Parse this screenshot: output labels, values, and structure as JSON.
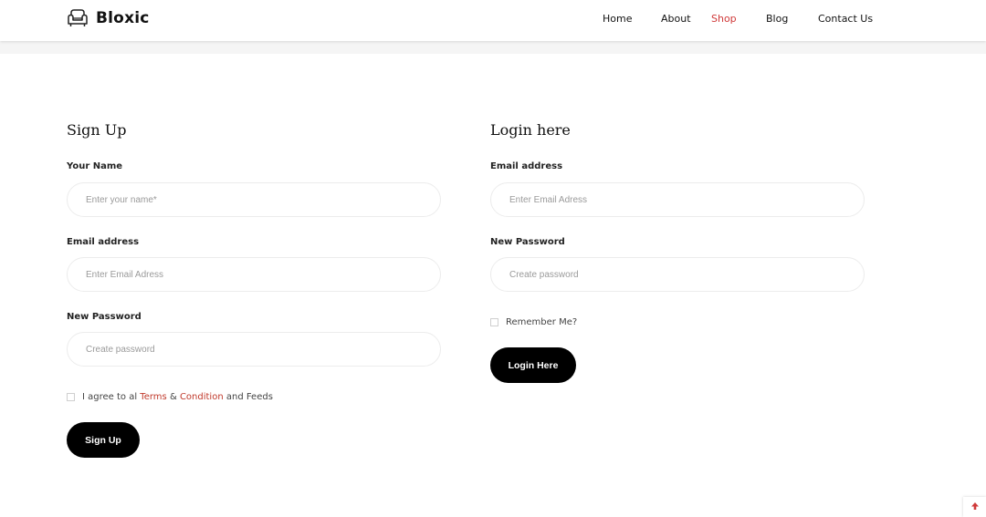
{
  "brand": {
    "name": "Bloxic",
    "logo_icon": "armchair-icon"
  },
  "nav": {
    "items": [
      {
        "label": "Home",
        "active": false
      },
      {
        "label": "About",
        "active": false
      },
      {
        "label": "Shop",
        "active": true
      },
      {
        "label": "Blog",
        "active": false
      },
      {
        "label": "Contact Us",
        "active": false
      }
    ]
  },
  "signup": {
    "title": "Sign Up",
    "name_label": "Your Name",
    "name_placeholder": "Enter your name*",
    "email_label": "Email address",
    "email_placeholder": "Enter Email Adress",
    "password_label": "New Password",
    "password_placeholder": "Create password",
    "agree": {
      "prefix": "I agree to al",
      "terms": "Terms",
      "amp": "&",
      "condition": "Condition",
      "suffix": "and Feeds"
    },
    "button": "Sign Up"
  },
  "login": {
    "title": "Login here",
    "email_label": "Email address",
    "email_placeholder": "Enter Email Adress",
    "password_label": "New Password",
    "password_placeholder": "Create password",
    "remember": "Remember Me?",
    "button": "Login Here"
  },
  "scroll_top": {
    "icon": "arrow-up-icon"
  },
  "colors": {
    "accent": "#d03a3a",
    "button": "#000000"
  }
}
